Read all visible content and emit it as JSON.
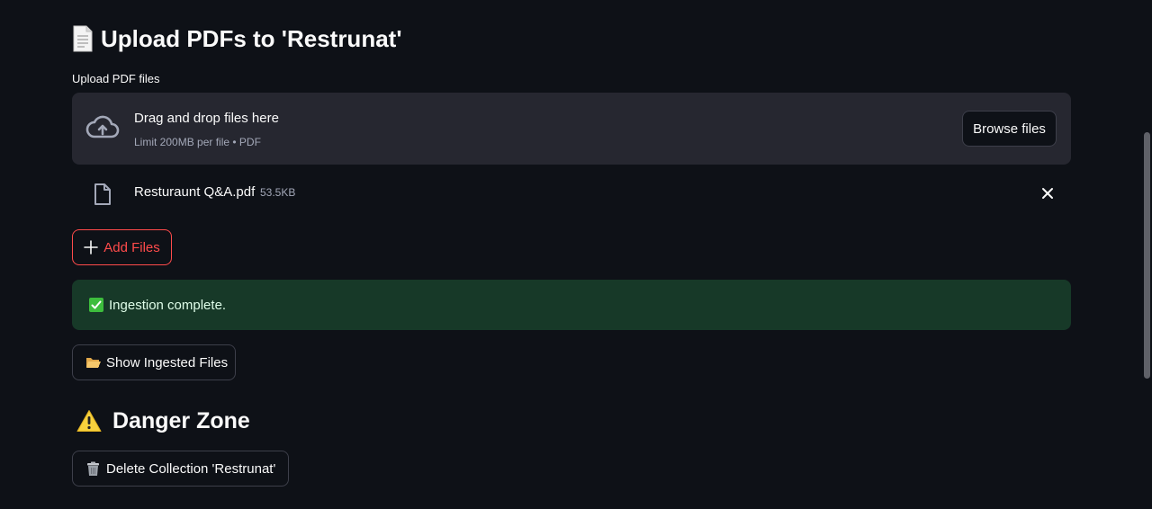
{
  "header": {
    "title": "Upload PDFs to 'Restrunat'",
    "icon": "document-icon"
  },
  "uploader": {
    "label": "Upload PDF files",
    "drop_title": "Drag and drop files here",
    "drop_subtitle": "Limit 200MB per file • PDF",
    "browse_label": "Browse files"
  },
  "files": [
    {
      "name": "Resturaunt Q&A.pdf",
      "size": "53.5KB"
    }
  ],
  "add_files_label": "Add Files",
  "status": {
    "message": "Ingestion complete.",
    "color": "#173928"
  },
  "show_button_label": "Show Ingested Files",
  "danger": {
    "title": "Danger Zone",
    "delete_label": "Delete Collection 'Restrunat'"
  },
  "colors": {
    "background": "#0e1117",
    "accent": "#ff4b4b",
    "panel": "#262730"
  }
}
